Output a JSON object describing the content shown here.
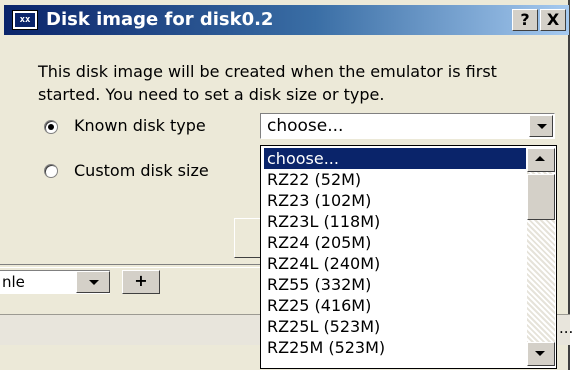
{
  "dialog": {
    "title": "Disk image for disk0.2",
    "title_icon_text": "xx",
    "help_button": "?",
    "close_button": "X",
    "description": "This disk image will be created when the emulator is first started. You need to set a disk size or type.",
    "options": {
      "known": "Known disk type",
      "custom": "Custom disk size",
      "selected": "known"
    },
    "combo": {
      "value": "choose..."
    },
    "dropdown": {
      "items": [
        "choose...",
        "RZ22 (52M)",
        "RZ23 (102M)",
        "RZ23L (118M)",
        "RZ24 (205M)",
        "RZ24L (240M)",
        "RZ55 (332M)",
        "RZ25 (416M)",
        "RZ25L (523M)",
        "RZ25M (523M)"
      ],
      "highlighted_index": 0
    }
  },
  "background": {
    "select_text": "nle",
    "plus_label": "+",
    "ellipsis": "..."
  }
}
